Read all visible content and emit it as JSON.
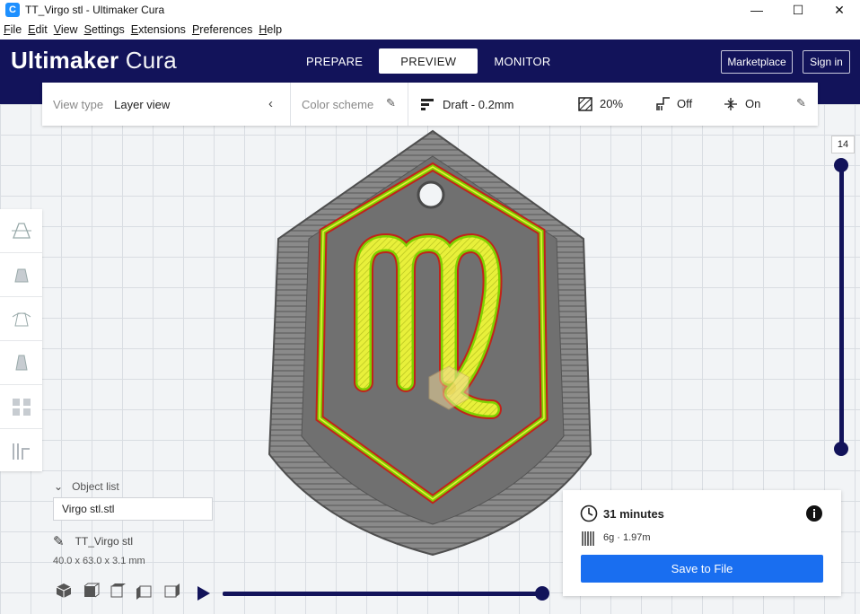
{
  "window": {
    "title": "TT_Virgo stl - Ultimaker Cura",
    "app_icon": "C"
  },
  "menu": [
    {
      "ul": "F",
      "rest": "ile"
    },
    {
      "ul": "E",
      "rest": "dit"
    },
    {
      "ul": "V",
      "rest": "iew"
    },
    {
      "ul": "S",
      "rest": "ettings"
    },
    {
      "ul": "E",
      "rest": "xtensions"
    },
    {
      "ul": "P",
      "rest": "references"
    },
    {
      "ul": "H",
      "rest": "elp"
    }
  ],
  "header": {
    "logo_bold": "Ultimaker",
    "logo_light": "Cura",
    "stages": [
      "PREPARE",
      "PREVIEW",
      "MONITOR"
    ],
    "active_stage": "PREVIEW",
    "marketplace": "Marketplace",
    "signin": "Sign in"
  },
  "view_panel": {
    "view_type_label": "View type",
    "view_type_value": "Layer view",
    "color_scheme_label": "Color scheme",
    "profile": "Draft - 0.2mm",
    "infill": "20%",
    "support": "Off",
    "adhesion": "On"
  },
  "layer_slider": {
    "current_layer": "14"
  },
  "object_list": {
    "label": "Object list",
    "selected_file": "Virgo stl.stl",
    "object_name": "TT_Virgo stl",
    "dimensions": "40.0 x 63.0 x 3.1 mm"
  },
  "print_summary": {
    "time": "31 minutes",
    "material": "6g · 1.97m",
    "save_button": "Save to File"
  },
  "colors": {
    "header_bg": "#12135a",
    "accent_blue": "#196ef0",
    "infill_yellow": "#e8f03a",
    "wall_green": "#7fd100",
    "wall_red": "#c0241b",
    "skin_gray": "#6d6d6d"
  }
}
